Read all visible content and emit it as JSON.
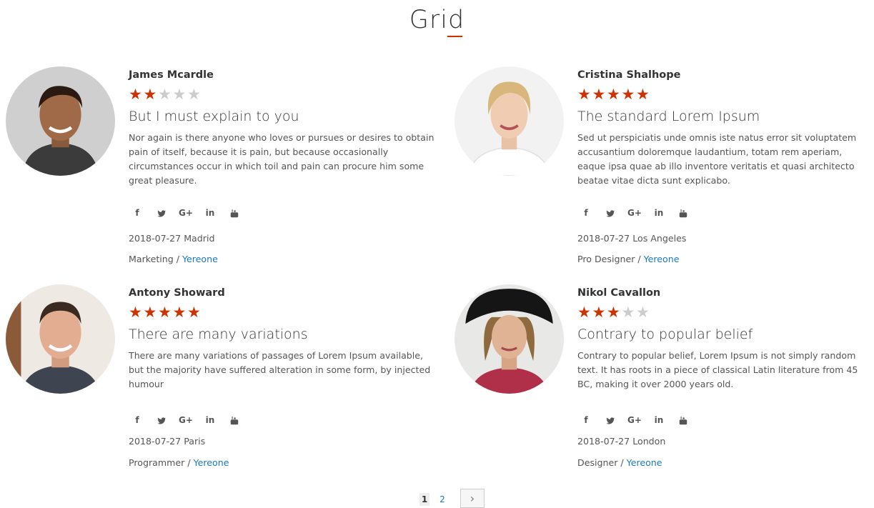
{
  "header": {
    "title": "Grid"
  },
  "colors": {
    "accent": "#cc3300",
    "link": "#1979c3",
    "star_off": "#cccccc"
  },
  "social_icons": [
    "facebook-icon",
    "twitter-icon",
    "google-plus-icon",
    "linkedin-icon",
    "youtube-icon"
  ],
  "testimonials": [
    {
      "name": "James Mcardle",
      "rating": 2,
      "headline": "But I must explain to you",
      "text": "Nor again is there anyone who loves or pursues or desires to obtain pain of itself, because it is pain, but because occasionally circumstances occur in which toil and pain can procure him some great pleasure.",
      "date_place": "2018-07-27 Madrid",
      "role": "Marketing",
      "company": "Yereone"
    },
    {
      "name": "Cristina Shalhope",
      "rating": 5,
      "headline": "The standard Lorem Ipsum",
      "text": "Sed ut perspiciatis unde omnis iste natus error sit voluptatem accusantium doloremque laudantium, totam rem aperiam, eaque ipsa quae ab illo inventore veritatis et quasi architecto beatae vitae dicta sunt explicabo.",
      "date_place": "2018-07-27 Los Angeles",
      "role": "Pro Designer",
      "company": "Yereone"
    },
    {
      "name": "Antony Showard",
      "rating": 5,
      "headline": "There are many variations",
      "text": "There are many variations of passages of Lorem Ipsum available, but the majority have suffered alteration in some form, by injected humour",
      "date_place": "2018-07-27 Paris",
      "role": "Programmer",
      "company": "Yereone"
    },
    {
      "name": "Nikol Cavallon",
      "rating": 3,
      "headline": "Contrary to popular belief",
      "text": "Contrary to popular belief, Lorem Ipsum is not simply random text. It has roots in a piece of classical Latin literature from 45 BC, making it over 2000 years old.",
      "date_place": "2018-07-27 London",
      "role": "Designer",
      "company": "Yereone"
    }
  ],
  "pagination": {
    "current": "1",
    "page2": "2",
    "next": "›"
  }
}
